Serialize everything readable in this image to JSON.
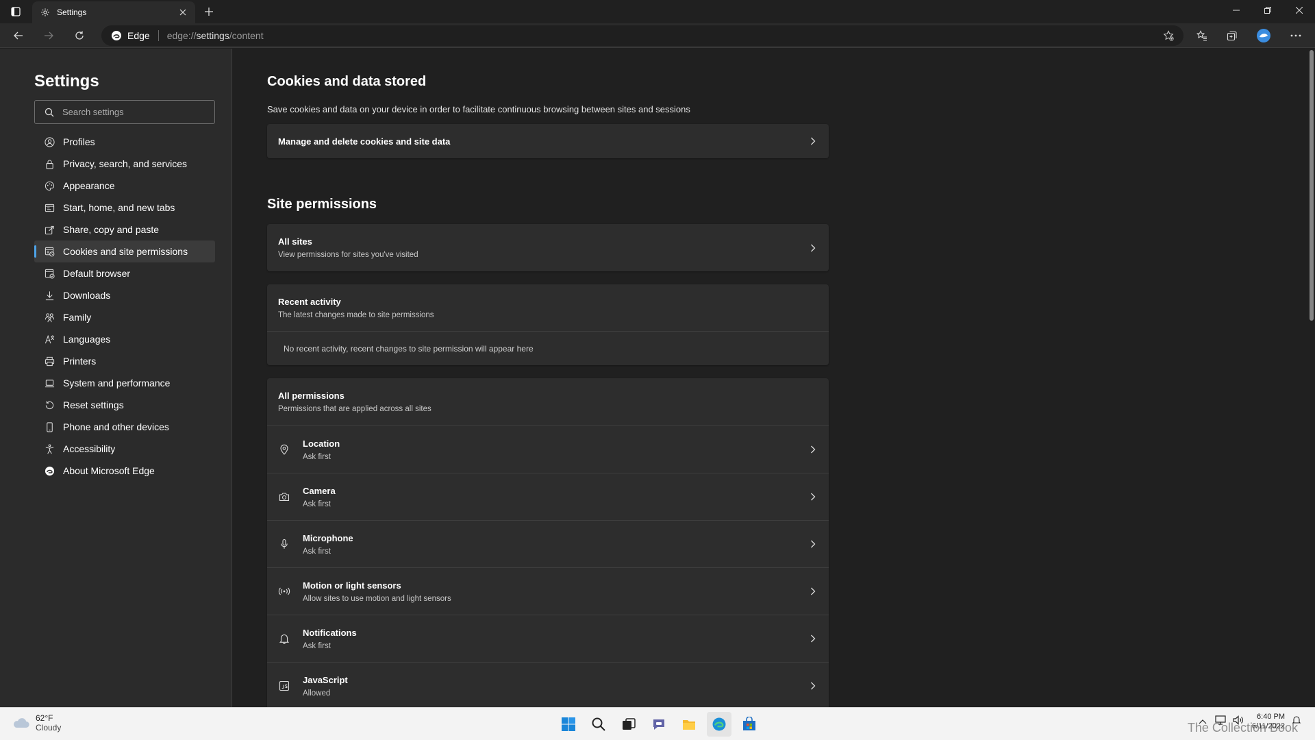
{
  "window": {
    "tab_title": "Settings",
    "colors": {
      "accent": "#4da3e8",
      "background": "#202020",
      "panel": "#2b2b2b",
      "card": "#2d2d2d"
    }
  },
  "toolbar": {
    "brand": "Edge",
    "url_prefix": "edge://",
    "url_highlight": "settings",
    "url_suffix": "/content"
  },
  "sidebar": {
    "title": "Settings",
    "search_placeholder": "Search settings",
    "items": [
      {
        "label": "Profiles",
        "icon": "profile-icon"
      },
      {
        "label": "Privacy, search, and services",
        "icon": "lock-icon"
      },
      {
        "label": "Appearance",
        "icon": "appearance-icon"
      },
      {
        "label": "Start, home, and new tabs",
        "icon": "home-tabs-icon"
      },
      {
        "label": "Share, copy and paste",
        "icon": "share-icon"
      },
      {
        "label": "Cookies and site permissions",
        "icon": "cookies-icon",
        "active": true
      },
      {
        "label": "Default browser",
        "icon": "browser-icon"
      },
      {
        "label": "Downloads",
        "icon": "download-icon"
      },
      {
        "label": "Family",
        "icon": "family-icon"
      },
      {
        "label": "Languages",
        "icon": "languages-icon"
      },
      {
        "label": "Printers",
        "icon": "printer-icon"
      },
      {
        "label": "System and performance",
        "icon": "laptop-icon"
      },
      {
        "label": "Reset settings",
        "icon": "reset-icon"
      },
      {
        "label": "Phone and other devices",
        "icon": "phone-icon"
      },
      {
        "label": "Accessibility",
        "icon": "accessibility-icon"
      },
      {
        "label": "About Microsoft Edge",
        "icon": "edge-icon"
      }
    ]
  },
  "main": {
    "cookies": {
      "heading": "Cookies and data stored",
      "description": "Save cookies and data on your device in order to facilitate continuous browsing between sites and sessions",
      "manage_label": "Manage and delete cookies and site data"
    },
    "site_permissions": {
      "heading": "Site permissions",
      "all_sites": {
        "title": "All sites",
        "subtitle": "View permissions for sites you've visited"
      },
      "recent_activity": {
        "title": "Recent activity",
        "subtitle": "The latest changes made to site permissions",
        "empty": "No recent activity, recent changes to site permission will appear here"
      },
      "all_permissions": {
        "title": "All permissions",
        "subtitle": "Permissions that are applied across all sites",
        "items": [
          {
            "title": "Location",
            "status": "Ask first",
            "icon": "location-icon"
          },
          {
            "title": "Camera",
            "status": "Ask first",
            "icon": "camera-icon"
          },
          {
            "title": "Microphone",
            "status": "Ask first",
            "icon": "microphone-icon"
          },
          {
            "title": "Motion or light sensors",
            "status": "Allow sites to use motion and light sensors",
            "icon": "sensors-icon"
          },
          {
            "title": "Notifications",
            "status": "Ask first",
            "icon": "bell-icon"
          },
          {
            "title": "JavaScript",
            "status": "Allowed",
            "icon": "javascript-icon"
          }
        ]
      }
    }
  },
  "taskbar": {
    "weather_temp": "62°F",
    "weather_condition": "Cloudy",
    "time": "6:40 PM",
    "date": "6/11/2022",
    "watermark": "The Collection Book"
  }
}
